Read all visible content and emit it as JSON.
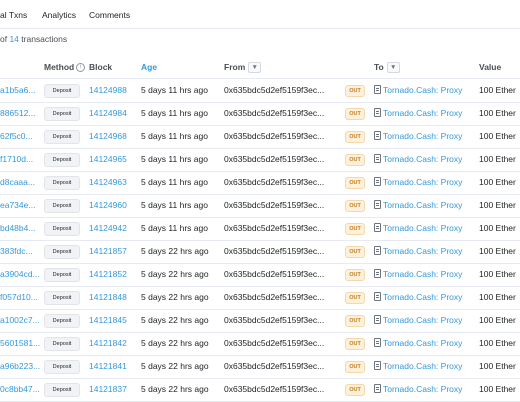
{
  "tabs": [
    "al Txns",
    "Analytics",
    "Comments"
  ],
  "summary": {
    "prefix": "of ",
    "count": "14",
    "suffix": " transactions"
  },
  "columns": {
    "method": "Method",
    "block": "Block",
    "age": "Age",
    "from": "From",
    "to": "To",
    "value": "Value"
  },
  "icons": {
    "filter": "funnel-icon",
    "info": "info-icon",
    "contract": "document-icon"
  },
  "rows": [
    {
      "hash": "a1b5a6...",
      "method": "Deposit",
      "block": "14124988",
      "age": "5 days 11 hrs ago",
      "from": "0x635bdc5d2ef5159f3ec...",
      "dir": "OUT",
      "to": "Tornado.Cash: Proxy",
      "value": "100 Ether"
    },
    {
      "hash": "886512...",
      "method": "Deposit",
      "block": "14124984",
      "age": "5 days 11 hrs ago",
      "from": "0x635bdc5d2ef5159f3ec...",
      "dir": "OUT",
      "to": "Tornado.Cash: Proxy",
      "value": "100 Ether"
    },
    {
      "hash": "62f5c0...",
      "method": "Deposit",
      "block": "14124968",
      "age": "5 days 11 hrs ago",
      "from": "0x635bdc5d2ef5159f3ec...",
      "dir": "OUT",
      "to": "Tornado.Cash: Proxy",
      "value": "100 Ether"
    },
    {
      "hash": "f1710d...",
      "method": "Deposit",
      "block": "14124965",
      "age": "5 days 11 hrs ago",
      "from": "0x635bdc5d2ef5159f3ec...",
      "dir": "OUT",
      "to": "Tornado.Cash: Proxy",
      "value": "100 Ether"
    },
    {
      "hash": "d8caaa...",
      "method": "Deposit",
      "block": "14124963",
      "age": "5 days 11 hrs ago",
      "from": "0x635bdc5d2ef5159f3ec...",
      "dir": "OUT",
      "to": "Tornado.Cash: Proxy",
      "value": "100 Ether"
    },
    {
      "hash": "ea734e...",
      "method": "Deposit",
      "block": "14124960",
      "age": "5 days 11 hrs ago",
      "from": "0x635bdc5d2ef5159f3ec...",
      "dir": "OUT",
      "to": "Tornado.Cash: Proxy",
      "value": "100 Ether"
    },
    {
      "hash": "bd48b4...",
      "method": "Deposit",
      "block": "14124942",
      "age": "5 days 11 hrs ago",
      "from": "0x635bdc5d2ef5159f3ec...",
      "dir": "OUT",
      "to": "Tornado.Cash: Proxy",
      "value": "100 Ether"
    },
    {
      "hash": "383fdc...",
      "method": "Deposit",
      "block": "14121857",
      "age": "5 days 22 hrs ago",
      "from": "0x635bdc5d2ef5159f3ec...",
      "dir": "OUT",
      "to": "Tornado.Cash: Proxy",
      "value": "100 Ether"
    },
    {
      "hash": "a3904cd...",
      "method": "Deposit",
      "block": "14121852",
      "age": "5 days 22 hrs ago",
      "from": "0x635bdc5d2ef5159f3ec...",
      "dir": "OUT",
      "to": "Tornado.Cash: Proxy",
      "value": "100 Ether"
    },
    {
      "hash": "f057d10...",
      "method": "Deposit",
      "block": "14121848",
      "age": "5 days 22 hrs ago",
      "from": "0x635bdc5d2ef5159f3ec...",
      "dir": "OUT",
      "to": "Tornado.Cash: Proxy",
      "value": "100 Ether"
    },
    {
      "hash": "a1002c7...",
      "method": "Deposit",
      "block": "14121845",
      "age": "5 days 22 hrs ago",
      "from": "0x635bdc5d2ef5159f3ec...",
      "dir": "OUT",
      "to": "Tornado.Cash: Proxy",
      "value": "100 Ether"
    },
    {
      "hash": "5601581...",
      "method": "Deposit",
      "block": "14121842",
      "age": "5 days 22 hrs ago",
      "from": "0x635bdc5d2ef5159f3ec...",
      "dir": "OUT",
      "to": "Tornado.Cash: Proxy",
      "value": "100 Ether"
    },
    {
      "hash": "a96b223...",
      "method": "Deposit",
      "block": "14121841",
      "age": "5 days 22 hrs ago",
      "from": "0x635bdc5d2ef5159f3ec...",
      "dir": "OUT",
      "to": "Tornado.Cash: Proxy",
      "value": "100 Ether"
    },
    {
      "hash": "0c8bb47...",
      "method": "Deposit",
      "block": "14121837",
      "age": "5 days 22 hrs ago",
      "from": "0x635bdc5d2ef5159f3ec...",
      "dir": "OUT",
      "to": "Tornado.Cash: Proxy",
      "value": "100 Ether"
    }
  ],
  "colors": {
    "link": "#3498db",
    "out_badge_bg": "#fdf0dc",
    "out_badge_text": "#c47e1c",
    "border": "#e7eaf3"
  }
}
